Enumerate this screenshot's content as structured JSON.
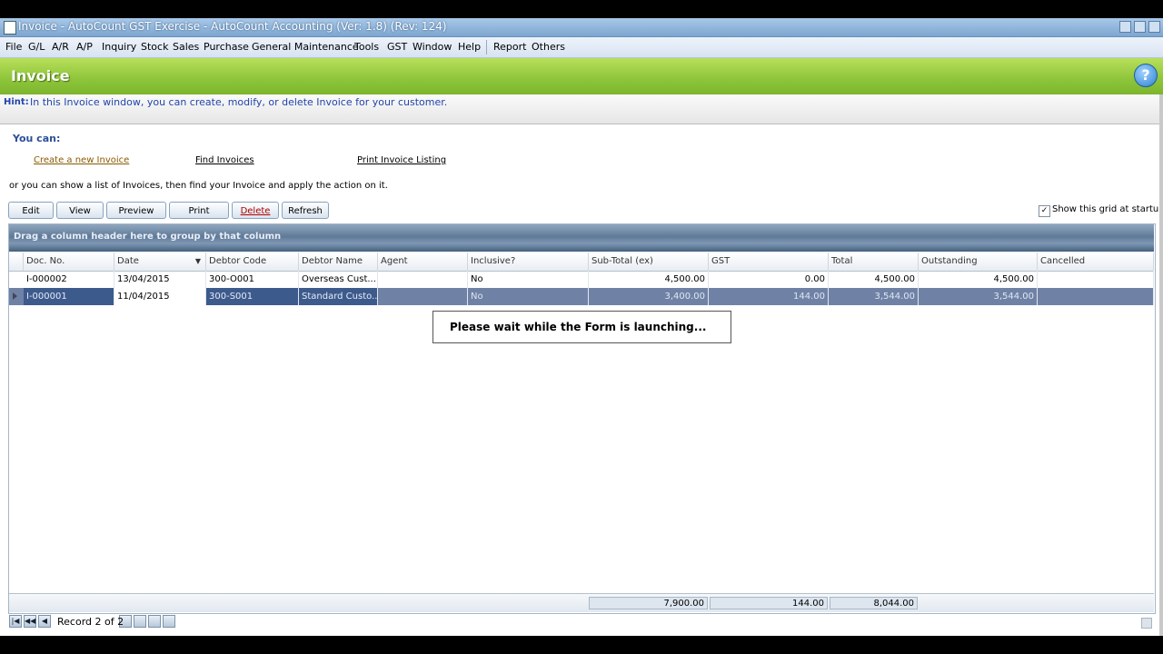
{
  "window": {
    "title": "Invoice - AutoCount GST Exercise - AutoCount Accounting (Ver: 1.8) (Rev: 124)"
  },
  "menu": {
    "items": [
      "File",
      "G/L",
      "A/R",
      "A/P",
      "Inquiry",
      "Stock",
      "Sales",
      "Purchase",
      "General Maintenance",
      "Tools",
      "GST",
      "Window",
      "Help",
      "Report",
      "Others"
    ]
  },
  "header": {
    "title": "Invoice",
    "help_glyph": "?"
  },
  "hint": {
    "label": "Hint:",
    "text": "In this Invoice window, you can create, modify, or delete Invoice for your customer."
  },
  "actions": {
    "you_can": "You can:",
    "create_link": "Create a new Invoice",
    "find_link": "Find Invoices",
    "print_link": "Print Invoice Listing",
    "or_text": "or you can show a list of Invoices, then find your Invoice and apply the action on it."
  },
  "toolbar": {
    "edit": "Edit",
    "view": "View",
    "preview": "Preview",
    "print": "Print",
    "delete": "Delete",
    "refresh": "Refresh",
    "show_grid_label": "Show this grid at startup",
    "show_grid_checked": "✓"
  },
  "grid": {
    "group_hint": "Drag a column header here to group by that column",
    "columns": [
      "Doc. No.",
      "Date",
      "Debtor Code",
      "Debtor Name",
      "Agent",
      "Inclusive?",
      "Sub-Total (ex)",
      "GST",
      "Total",
      "Outstanding",
      "Cancelled"
    ],
    "rows": [
      {
        "doc_no": "I-000002",
        "date": "13/04/2015",
        "debtor_code": "300-O001",
        "debtor_name": "Overseas Cust...",
        "agent": "",
        "inclusive": "No",
        "subtotal": "4,500.00",
        "gst": "0.00",
        "total": "4,500.00",
        "outstanding": "4,500.00",
        "cancelled": ""
      },
      {
        "doc_no": "I-000001",
        "date": "11/04/2015",
        "debtor_code": "300-S001",
        "debtor_name": "Standard Custo...",
        "agent": "",
        "inclusive": "No",
        "subtotal": "3,400.00",
        "gst": "144.00",
        "total": "3,544.00",
        "outstanding": "3,544.00",
        "cancelled": ""
      }
    ],
    "totals": {
      "subtotal": "7,900.00",
      "gst": "144.00",
      "total": "8,044.00"
    }
  },
  "popup": {
    "text": "Please wait while the Form is launching..."
  },
  "navigator": {
    "record_text": "Record 2 of 2"
  }
}
